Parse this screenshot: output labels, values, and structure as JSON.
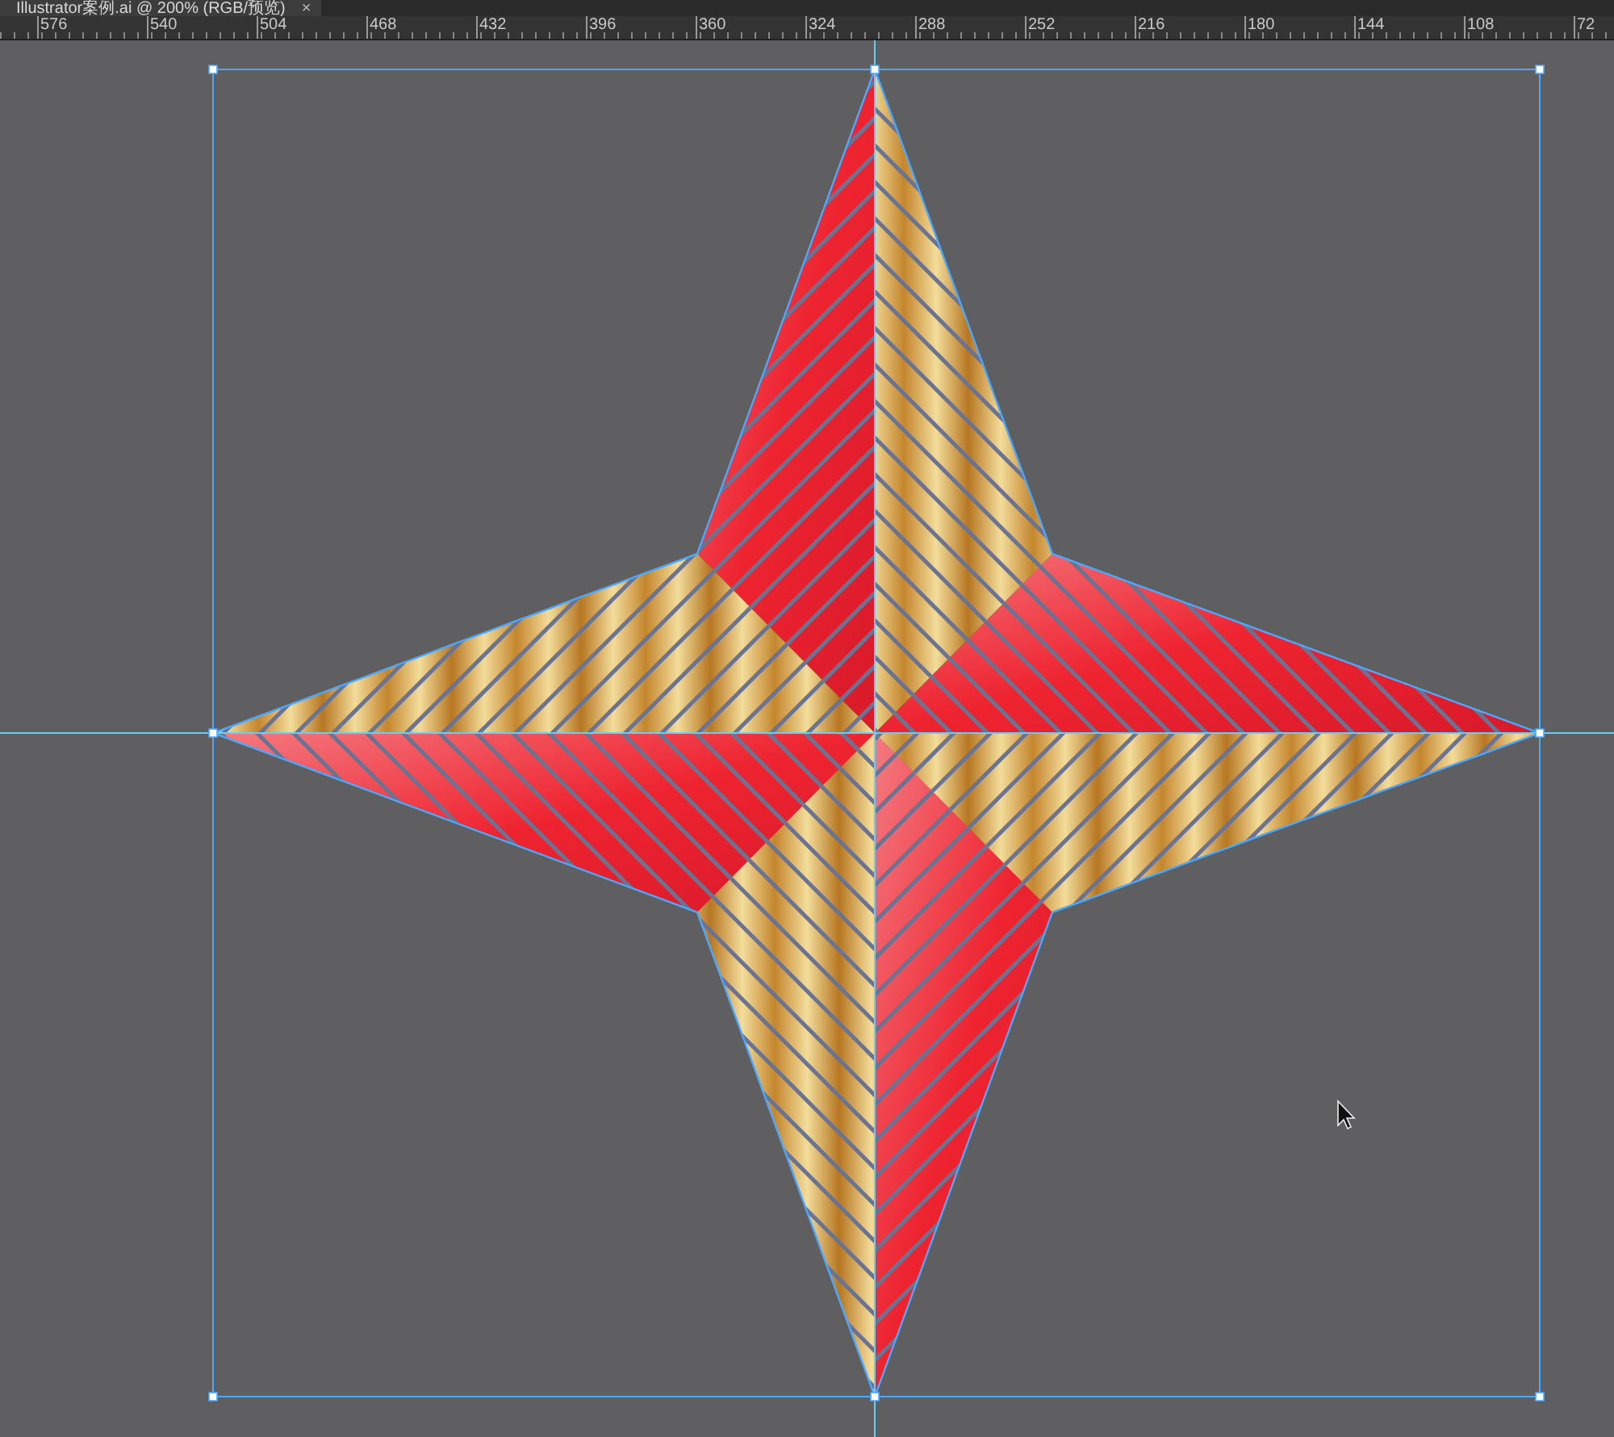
{
  "document_tab": {
    "title": "Illustrator案例.ai @ 200% (RGB/预览)",
    "close": "×"
  },
  "ruler": {
    "labels": [
      "576",
      "540",
      "504",
      "468",
      "432",
      "396",
      "360",
      "324",
      "288",
      "252",
      "216",
      "180",
      "144",
      "108",
      "72"
    ]
  },
  "artwork": {
    "selected": true
  }
}
